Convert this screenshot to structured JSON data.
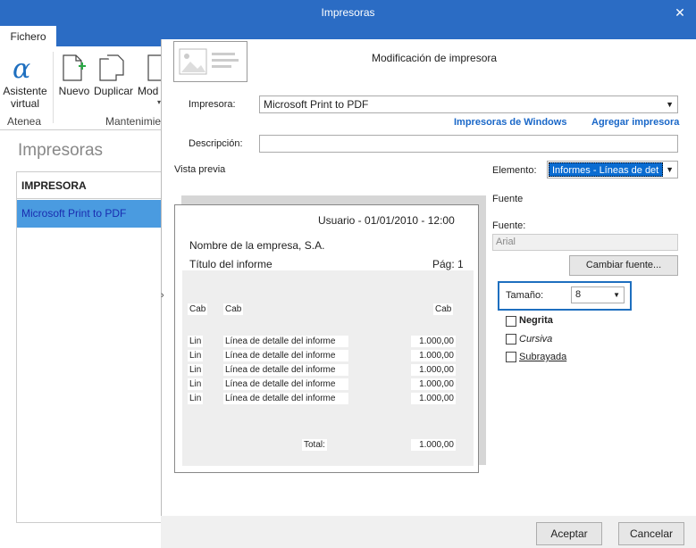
{
  "window": {
    "title": "Impresoras"
  },
  "ribbon": {
    "tab": "Fichero",
    "asistente_line1": "Asistente",
    "asistente_line2": "virtual",
    "nuevo": "Nuevo",
    "duplicar": "Duplicar",
    "modificar_partial": "Mod",
    "group_atenea": "Atenea",
    "group_mantenimiento_partial": "Mantenimie"
  },
  "left_pane": {
    "title": "Impresoras",
    "column_header": "IMPRESORA",
    "rows": [
      "Microsoft Print to PDF"
    ]
  },
  "dialog": {
    "title": "Modificación de impresora",
    "impresora_label": "Impresora:",
    "impresora_value": "Microsoft Print to PDF",
    "link_windows": "Impresoras de Windows",
    "link_agregar": "Agregar impresora",
    "descripcion_label": "Descripción:",
    "descripcion_value": "",
    "vista_previa_label": "Vista previa",
    "elemento_label": "Elemento:",
    "elemento_value": "Informes - Líneas de det",
    "fuente_section": "Fuente",
    "fuente_label": "Fuente:",
    "fuente_value": "Arial",
    "cambiar_fuente": "Cambiar fuente...",
    "tamano_label": "Tamaño:",
    "tamano_value": "8",
    "negrita": "Negrita",
    "cursiva": "Cursiva",
    "subrayada": "Subrayada",
    "aceptar": "Aceptar",
    "cancelar": "Cancelar"
  },
  "preview": {
    "usuario": "Usuario - 01/01/2010 - 12:00",
    "empresa": "Nombre de la empresa, S.A.",
    "titulo": "Título del informe",
    "pagina": "Pág: 1",
    "header": {
      "c1": "Cab",
      "c2": "Cab",
      "c3": "Cab"
    },
    "lines": [
      {
        "c1": "Lin",
        "c2": "Línea de detalle del informe",
        "c3": "1.000,00"
      },
      {
        "c1": "Lin",
        "c2": "Línea de detalle del informe",
        "c3": "1.000,00"
      },
      {
        "c1": "Lin",
        "c2": "Línea de detalle del informe",
        "c3": "1.000,00"
      },
      {
        "c1": "Lin",
        "c2": "Línea de detalle del informe",
        "c3": "1.000,00"
      },
      {
        "c1": "Lin",
        "c2": "Línea de detalle del informe",
        "c3": "1.000,00"
      }
    ],
    "total_label": "Total:",
    "total_value": "1.000,00"
  },
  "colors": {
    "titlebar": "#2b6cc4",
    "selection": "#4a9be0",
    "link": "#1967c8",
    "focus_border": "#1e6fbf"
  }
}
